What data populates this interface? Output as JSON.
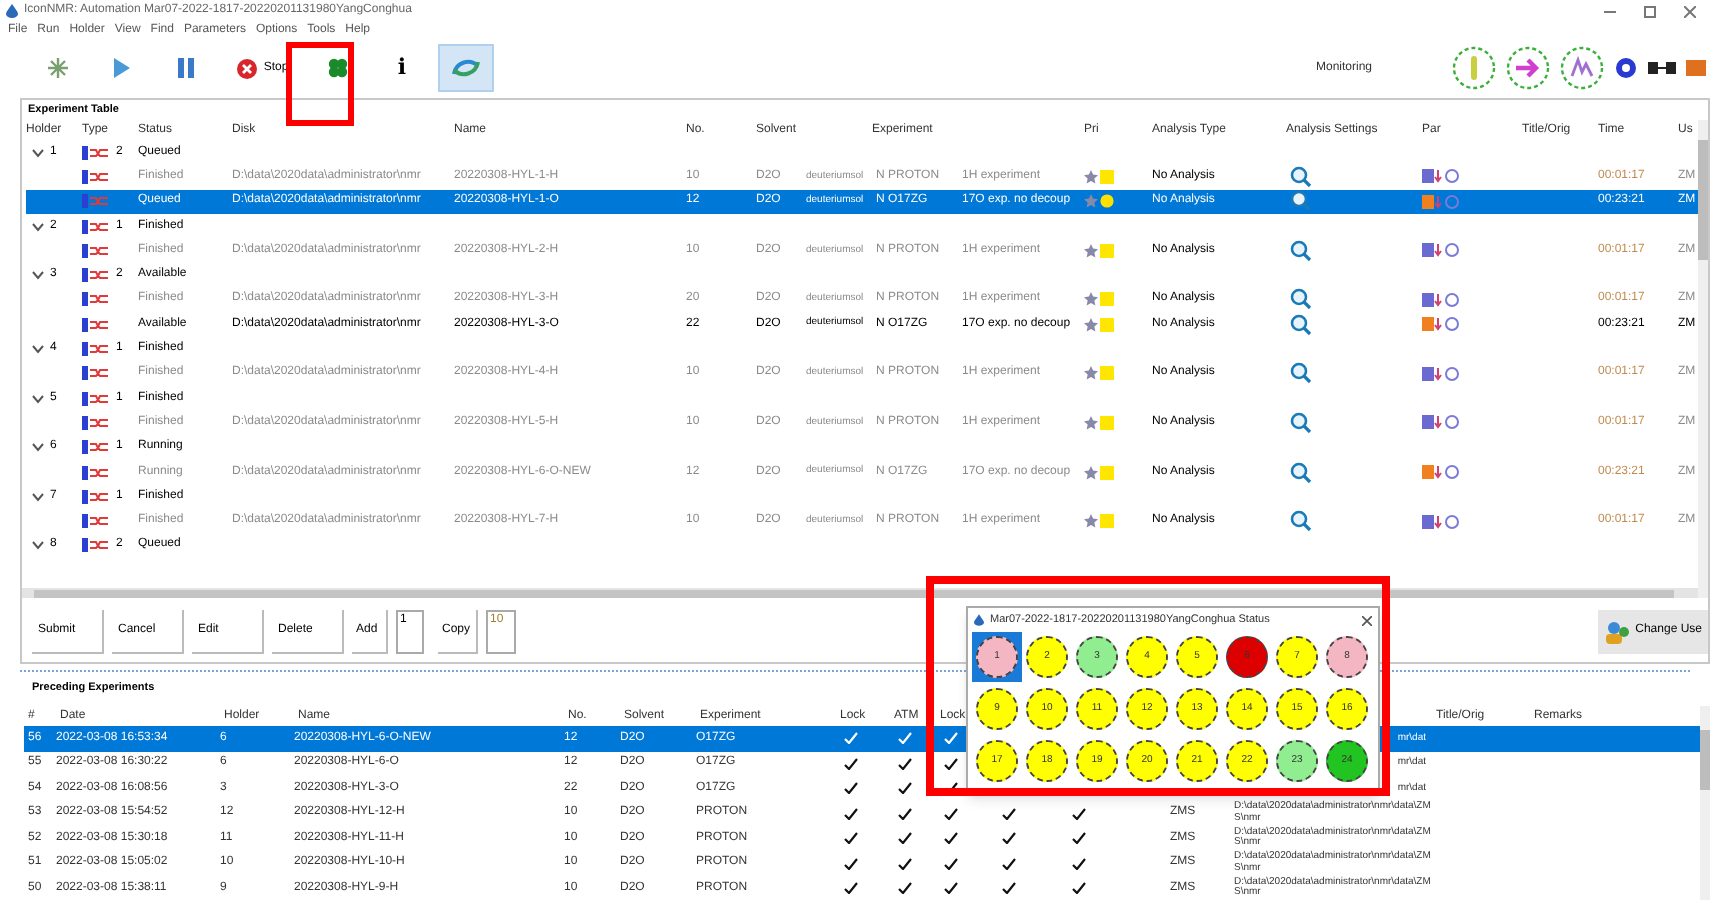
{
  "window": {
    "title": "IconNMR: Automation Mar07-2022-1817-20220201131980YangConghua"
  },
  "menu": [
    "File",
    "Run",
    "Holder",
    "View",
    "Find",
    "Parameters",
    "Options",
    "Tools",
    "Help"
  ],
  "toolbar": [
    {
      "kind": "sparkle",
      "selected": false
    },
    {
      "kind": "play",
      "selected": false
    },
    {
      "kind": "pause",
      "selected": false
    },
    {
      "kind": "stop",
      "label": "Stop",
      "selected": false
    },
    {
      "kind": "clover",
      "selected": false
    },
    {
      "kind": "info",
      "label": "i",
      "selected": false
    },
    {
      "kind": "swirl",
      "selected": true
    }
  ],
  "mode_label": "Monitoring",
  "experiment_table": {
    "title": "Experiment Table",
    "columns": [
      "Holder",
      "Type",
      "Status",
      "Disk",
      "Name",
      "No.",
      "Solvent",
      "Experiment",
      "Pri",
      "Analysis Type",
      "Analysis Settings",
      "Par",
      "Title/Orig",
      "Time",
      "Us"
    ],
    "rows": [
      {
        "kind": "group",
        "holder": "1",
        "count": "2",
        "status": "Queued",
        "expanded": true
      },
      {
        "kind": "experiment",
        "status": "Finished",
        "greyed": true,
        "selected": false,
        "disk": "D:\\data\\2020data\\administrator\\nmr",
        "name": "20220308-HYL-1-H",
        "no": "10",
        "solvent": "D2O",
        "solvent_dir": "deuteriumsol",
        "nucleus": "N PROTON",
        "description": "1H experiment",
        "analysis_type": "No Analysis",
        "par_warning": false,
        "time": "00:01:17",
        "user": "ZM"
      },
      {
        "kind": "experiment",
        "status": "Queued",
        "selected": true,
        "disk": "D:\\data\\2020data\\administrator\\nmr",
        "name": "20220308-HYL-1-O",
        "no": "12",
        "solvent": "D2O",
        "solvent_dir": "deuteriumsol",
        "nucleus": "N O17ZG",
        "description": "17O exp. no decoup",
        "analysis_type": "No Analysis",
        "par_warning": true,
        "time": "00:23:21",
        "user": "ZM"
      },
      {
        "kind": "group",
        "holder": "2",
        "count": "1",
        "status": "Finished",
        "expanded": true
      },
      {
        "kind": "experiment",
        "status": "Finished",
        "greyed": true,
        "selected": false,
        "disk": "D:\\data\\2020data\\administrator\\nmr",
        "name": "20220308-HYL-2-H",
        "no": "10",
        "solvent": "D2O",
        "solvent_dir": "deuteriumsol",
        "nucleus": "N PROTON",
        "description": "1H experiment",
        "analysis_type": "No Analysis",
        "par_warning": false,
        "time": "00:01:17",
        "user": "ZM"
      },
      {
        "kind": "group",
        "holder": "3",
        "count": "2",
        "status": "Available",
        "expanded": true
      },
      {
        "kind": "experiment",
        "status": "Finished",
        "greyed": true,
        "selected": false,
        "disk": "D:\\data\\2020data\\administrator\\nmr",
        "name": "20220308-HYL-3-H",
        "no": "20",
        "solvent": "D2O",
        "solvent_dir": "deuteriumsol",
        "nucleus": "N PROTON",
        "description": "1H experiment",
        "analysis_type": "No Analysis",
        "par_warning": false,
        "time": "00:01:17",
        "user": "ZM"
      },
      {
        "kind": "experiment",
        "status": "Available",
        "greyed": false,
        "selected": false,
        "disk": "D:\\data\\2020data\\administrator\\nmr",
        "name": "20220308-HYL-3-O",
        "no": "22",
        "solvent": "D2O",
        "solvent_dir": "deuteriumsol",
        "nucleus": "N O17ZG",
        "description": "17O exp. no decoup",
        "analysis_type": "No Analysis",
        "par_warning": true,
        "time": "00:23:21",
        "user": "ZM"
      },
      {
        "kind": "group",
        "holder": "4",
        "count": "1",
        "status": "Finished",
        "expanded": true
      },
      {
        "kind": "experiment",
        "status": "Finished",
        "greyed": true,
        "selected": false,
        "disk": "D:\\data\\2020data\\administrator\\nmr",
        "name": "20220308-HYL-4-H",
        "no": "10",
        "solvent": "D2O",
        "solvent_dir": "deuteriumsol",
        "nucleus": "N PROTON",
        "description": "1H experiment",
        "analysis_type": "No Analysis",
        "par_warning": false,
        "time": "00:01:17",
        "user": "ZM"
      },
      {
        "kind": "group",
        "holder": "5",
        "count": "1",
        "status": "Finished",
        "expanded": true
      },
      {
        "kind": "experiment",
        "status": "Finished",
        "greyed": true,
        "selected": false,
        "disk": "D:\\data\\2020data\\administrator\\nmr",
        "name": "20220308-HYL-5-H",
        "no": "10",
        "solvent": "D2O",
        "solvent_dir": "deuteriumsol",
        "nucleus": "N PROTON",
        "description": "1H experiment",
        "analysis_type": "No Analysis",
        "par_warning": false,
        "time": "00:01:17",
        "user": "ZM"
      },
      {
        "kind": "group",
        "holder": "6",
        "count": "1",
        "status": "Running",
        "expanded": true
      },
      {
        "kind": "experiment",
        "status": "Running",
        "greyed": true,
        "selected": false,
        "disk": "D:\\data\\2020data\\administrator\\nmr",
        "name": "20220308-HYL-6-O-NEW",
        "no": "12",
        "solvent": "D2O",
        "solvent_dir": "deuteriumsol",
        "nucleus": "N O17ZG",
        "description": "17O exp. no decoup",
        "analysis_type": "No Analysis",
        "par_warning": true,
        "time": "00:23:21",
        "user": "ZM"
      },
      {
        "kind": "group",
        "holder": "7",
        "count": "1",
        "status": "Finished",
        "expanded": true
      },
      {
        "kind": "experiment",
        "status": "Finished",
        "greyed": true,
        "selected": false,
        "disk": "D:\\data\\2020data\\administrator\\nmr",
        "name": "20220308-HYL-7-H",
        "no": "10",
        "solvent": "D2O",
        "solvent_dir": "deuteriumsol",
        "nucleus": "N PROTON",
        "description": "1H experiment",
        "analysis_type": "No Analysis",
        "par_warning": false,
        "time": "00:01:17",
        "user": "ZM"
      },
      {
        "kind": "group",
        "holder": "8",
        "count": "2",
        "status": "Queued",
        "expanded": true
      }
    ]
  },
  "actions": {
    "buttons": [
      "Submit",
      "Cancel",
      "Edit",
      "Delete"
    ],
    "add": {
      "label": "Add",
      "value": "1"
    },
    "copy": {
      "label": "Copy",
      "value": "10"
    },
    "change_user": "Change Use"
  },
  "preceding": {
    "title": "Preceding Experiments",
    "columns": [
      "#",
      "Date",
      "Holder",
      "Name",
      "No.",
      "Solvent",
      "Experiment",
      "Lock",
      "ATM",
      "Lock",
      "Title/Orig",
      "Remarks"
    ],
    "rows": [
      {
        "num": "56",
        "date": "2022-03-08 16:53:34",
        "holder": "6",
        "name": "20220308-HYL-6-O-NEW",
        "no": "12",
        "solvent": "D2O",
        "experiment": "O17ZG",
        "checks": [
          true,
          true,
          true
        ],
        "path_tail": "mr\\dat",
        "selected": true
      },
      {
        "num": "55",
        "date": "2022-03-08 16:30:22",
        "holder": "6",
        "name": "20220308-HYL-6-O",
        "no": "12",
        "solvent": "D2O",
        "experiment": "O17ZG",
        "checks": [
          true,
          true,
          true
        ],
        "path_tail": "mr\\dat",
        "selected": false
      },
      {
        "num": "54",
        "date": "2022-03-08 16:08:56",
        "holder": "3",
        "name": "20220308-HYL-3-O",
        "no": "22",
        "solvent": "D2O",
        "experiment": "O17ZG",
        "checks": [
          true,
          true,
          true
        ],
        "path_tail": "mr\\dat",
        "selected": false
      },
      {
        "num": "53",
        "date": "2022-03-08 15:54:52",
        "holder": "12",
        "name": "20220308-HYL-12-H",
        "no": "10",
        "solvent": "D2O",
        "experiment": "PROTON",
        "checks": [
          true,
          true,
          true,
          true,
          true
        ],
        "shim": "ZMS",
        "path": "D:\\data\\2020data\\administrator\\nmr\\data\\ZMS\\nmr",
        "selected": false
      },
      {
        "num": "52",
        "date": "2022-03-08 15:30:18",
        "holder": "11",
        "name": "20220308-HYL-11-H",
        "no": "10",
        "solvent": "D2O",
        "experiment": "PROTON",
        "checks": [
          true,
          true,
          true,
          true,
          true
        ],
        "shim": "ZMS",
        "path": "D:\\data\\2020data\\administrator\\nmr\\data\\ZMS\\nmr",
        "selected": false
      },
      {
        "num": "51",
        "date": "2022-03-08 15:05:02",
        "holder": "10",
        "name": "20220308-HYL-10-H",
        "no": "10",
        "solvent": "D2O",
        "experiment": "PROTON",
        "checks": [
          true,
          true,
          true,
          true,
          true
        ],
        "shim": "ZMS",
        "path": "D:\\data\\2020data\\administrator\\nmr\\data\\ZMS\\nmr",
        "selected": false
      },
      {
        "num": "50",
        "date": "2022-03-08 15:38:11",
        "holder": "9",
        "name": "20220308-HYL-9-H",
        "no": "10",
        "solvent": "D2O",
        "experiment": "PROTON",
        "checks": [
          true,
          true,
          true,
          true,
          true
        ],
        "shim": "ZMS",
        "path": "D:\\data\\2020data\\administrator\\nmr\\data\\ZMS\\nmr",
        "selected": false
      }
    ]
  },
  "status_popup": {
    "title": "Mar07-2022-1817-20220201131980YangConghua Status",
    "positions": [
      {
        "label": "1",
        "color": "#f4b6c2",
        "selected": true
      },
      {
        "label": "2",
        "color": "#ffff00",
        "selected": false
      },
      {
        "label": "3",
        "color": "#90ee90",
        "selected": false
      },
      {
        "label": "4",
        "color": "#ffff00",
        "selected": false
      },
      {
        "label": "5",
        "color": "#ffff00",
        "selected": false
      },
      {
        "label": "6",
        "color": "#dd0000",
        "selected": false
      },
      {
        "label": "7",
        "color": "#ffff00",
        "selected": false
      },
      {
        "label": "8",
        "color": "#f4b6c2",
        "selected": false
      },
      {
        "label": "9",
        "color": "#ffff00",
        "selected": false
      },
      {
        "label": "10",
        "color": "#ffff00",
        "selected": false
      },
      {
        "label": "11",
        "color": "#ffff00",
        "selected": false
      },
      {
        "label": "12",
        "color": "#ffff00",
        "selected": false
      },
      {
        "label": "13",
        "color": "#ffff00",
        "selected": false
      },
      {
        "label": "14",
        "color": "#ffff00",
        "selected": false
      },
      {
        "label": "15",
        "color": "#ffff00",
        "selected": false
      },
      {
        "label": "16",
        "color": "#ffff00",
        "selected": false
      },
      {
        "label": "17",
        "color": "#ffff00",
        "selected": false
      },
      {
        "label": "18",
        "color": "#ffff00",
        "selected": false
      },
      {
        "label": "19",
        "color": "#ffff00",
        "selected": false
      },
      {
        "label": "20",
        "color": "#ffff00",
        "selected": false
      },
      {
        "label": "21",
        "color": "#ffff00",
        "selected": false
      },
      {
        "label": "22",
        "color": "#ffff00",
        "selected": false
      },
      {
        "label": "23",
        "color": "#90ee90",
        "selected": false
      },
      {
        "label": "24",
        "color": "#22c422",
        "selected": false
      }
    ]
  }
}
